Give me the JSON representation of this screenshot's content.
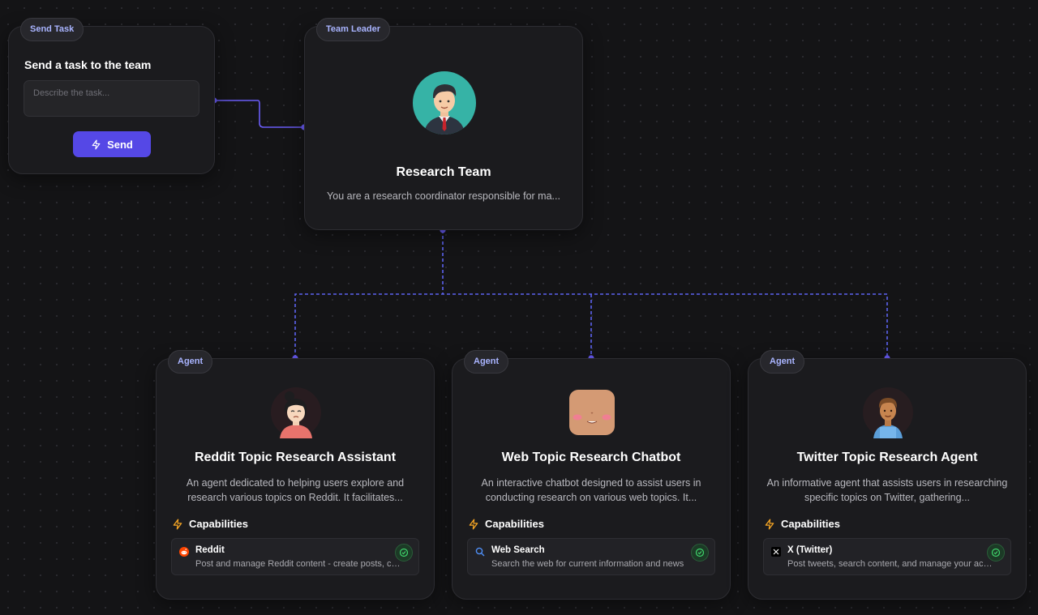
{
  "send_card": {
    "badge": "Send Task",
    "title": "Send a task to the team",
    "input_placeholder": "Describe the task...",
    "send_label": "Send"
  },
  "leader_card": {
    "badge": "Team Leader",
    "name": "Research Team",
    "description": "You are a research coordinator responsible for ma..."
  },
  "agents": [
    {
      "badge": "Agent",
      "name": "Reddit Topic Research Assistant",
      "description": "An agent dedicated to helping users explore and research various topics on Reddit. It facilitates...",
      "capabilities_label": "Capabilities",
      "capability": {
        "name": "Reddit",
        "description": "Post and manage Reddit content - create posts, comment, and interact with communities",
        "icon": "reddit-icon",
        "status": "enabled"
      }
    },
    {
      "badge": "Agent",
      "name": "Web Topic Research Chatbot",
      "description": "An interactive chatbot designed to assist users in conducting research on various web topics. It...",
      "capabilities_label": "Capabilities",
      "capability": {
        "name": "Web Search",
        "description": "Search the web for current information and news",
        "icon": "search-icon",
        "status": "enabled"
      }
    },
    {
      "badge": "Agent",
      "name": "Twitter Topic Research Agent",
      "description": "An informative agent that assists users in researching specific topics on Twitter, gathering...",
      "capabilities_label": "Capabilities",
      "capability": {
        "name": "X (Twitter)",
        "description": "Post tweets, search content, and manage your account",
        "icon": "x-icon",
        "status": "enabled"
      }
    }
  ],
  "colors": {
    "accent": "#5548e6",
    "connector": "#6a5cf5",
    "badge_text": "#a9b4ff",
    "capability_icon": "#f5a524",
    "check": "#3fd46b",
    "background": "#141416"
  }
}
